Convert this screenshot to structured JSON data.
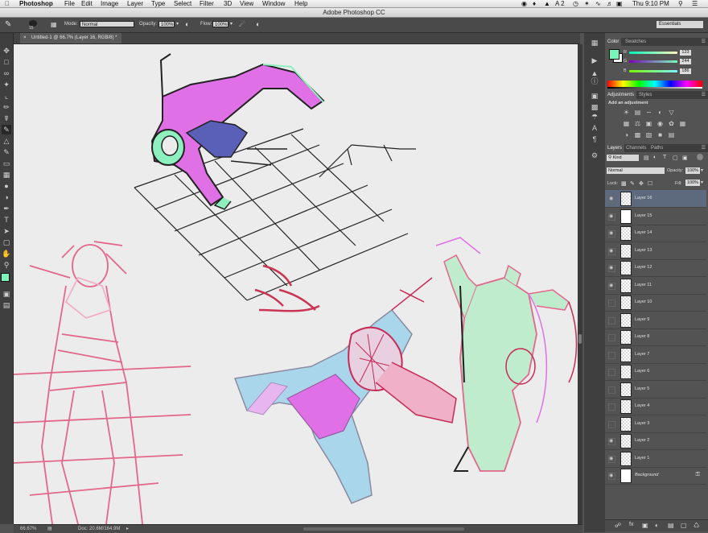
{
  "menubar": {
    "app": "Photoshop",
    "items": [
      "File",
      "Edit",
      "Image",
      "Layer",
      "Type",
      "Select",
      "Filter",
      "3D",
      "View",
      "Window",
      "Help"
    ],
    "status_extra": "A 2",
    "clock": "Thu 9:10 PM"
  },
  "window_title": "Adobe Photoshop CC",
  "options": {
    "brush_size": "15",
    "mode_label": "Mode:",
    "mode_value": "Normal",
    "opacity_label": "Opacity:",
    "opacity_value": "100%",
    "flow_label": "Flow:",
    "flow_value": "100%",
    "workspace": "Essentials"
  },
  "document": {
    "tab_title": "Untitled-1 @ 66.7% (Layer 16, RGB/8) *",
    "zoom": "66.67%",
    "doc_info": "Doc: 20.6M/164.9M"
  },
  "color_panel": {
    "tabs": [
      "Color",
      "Swatches"
    ],
    "r_label": "R",
    "g_label": "G",
    "b_label": "B",
    "r": "123",
    "g": "244",
    "b": "186",
    "fg_color": "#7bf4ba"
  },
  "adjustments_panel": {
    "tabs": [
      "Adjustments",
      "Styles"
    ],
    "heading": "Add an adjustment"
  },
  "layers_panel": {
    "tabs": [
      "Layers",
      "Channels",
      "Paths"
    ],
    "filter_label": "Kind",
    "blend_mode": "Normal",
    "opacity_label": "Opacity:",
    "opacity_value": "100%",
    "lock_label": "Lock:",
    "fill_label": "Fill:",
    "fill_value": "100%",
    "layers": [
      {
        "name": "Layer 16",
        "visible": true,
        "selected": true
      },
      {
        "name": "Layer 15",
        "visible": true,
        "selected": false
      },
      {
        "name": "Layer 14",
        "visible": true,
        "selected": false
      },
      {
        "name": "Layer 13",
        "visible": true,
        "selected": false
      },
      {
        "name": "Layer 12",
        "visible": true,
        "selected": false
      },
      {
        "name": "Layer 11",
        "visible": true,
        "selected": false
      },
      {
        "name": "Layer 10",
        "visible": false,
        "selected": false
      },
      {
        "name": "Layer 9",
        "visible": false,
        "selected": false
      },
      {
        "name": "Layer 8",
        "visible": false,
        "selected": false
      },
      {
        "name": "Layer 7",
        "visible": false,
        "selected": false
      },
      {
        "name": "Layer 6",
        "visible": false,
        "selected": false
      },
      {
        "name": "Layer 5",
        "visible": false,
        "selected": false
      },
      {
        "name": "Layer 4",
        "visible": false,
        "selected": false
      },
      {
        "name": "Layer 3",
        "visible": false,
        "selected": false
      },
      {
        "name": "Layer 2",
        "visible": true,
        "selected": false
      },
      {
        "name": "Layer 1",
        "visible": true,
        "selected": false
      },
      {
        "name": "Background",
        "visible": true,
        "selected": false
      }
    ]
  }
}
